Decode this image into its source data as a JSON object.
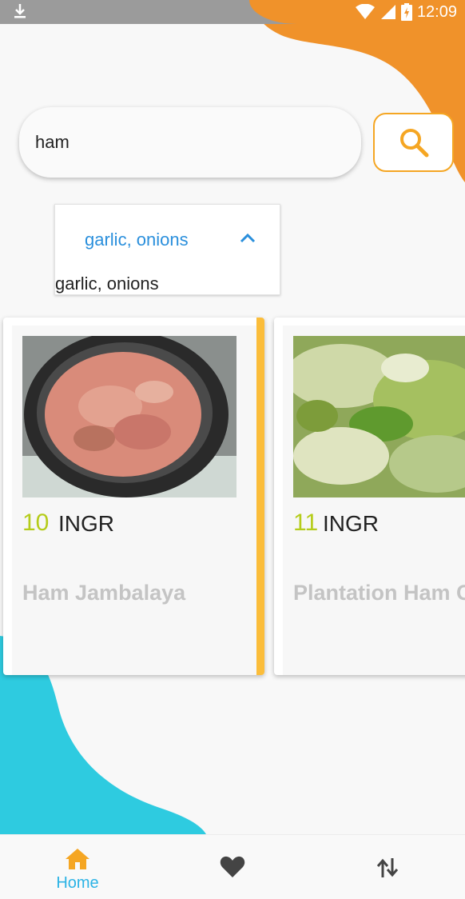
{
  "status_bar": {
    "time": "12:09",
    "icons": [
      "download-icon",
      "wifi-icon",
      "signal-icon",
      "battery-icon"
    ]
  },
  "search": {
    "value": "ham",
    "button_icon": "search-icon"
  },
  "filter_dropdown": {
    "selected": "garlic, onions",
    "option": "garlic, onions",
    "chevron_icon": "chevron-up-icon"
  },
  "recipes": [
    {
      "ingredient_count": "10",
      "ingredient_label": "INGR",
      "title": "Ham Jambalaya",
      "image": "ham-jambalaya-photo"
    },
    {
      "ingredient_count": "11",
      "ingredient_label": "INGR",
      "title": "Plantation Ham Cakes",
      "image": "plantation-ham-cakes-photo"
    }
  ],
  "bottom_nav": {
    "items": [
      {
        "label": "Home",
        "icon": "home-icon",
        "active": true
      },
      {
        "label": "",
        "icon": "heart-icon",
        "active": false
      },
      {
        "label": "",
        "icon": "sort-icon",
        "active": false
      }
    ]
  },
  "colors": {
    "orange_accent": "#f5a623",
    "teal_accent": "#2ecbe0",
    "ingredient_count": "#b5cc1a",
    "dropdown_text": "#2a8fdc",
    "active_nav": "#2cb3e5",
    "card_accent": "#fbbd3a"
  }
}
